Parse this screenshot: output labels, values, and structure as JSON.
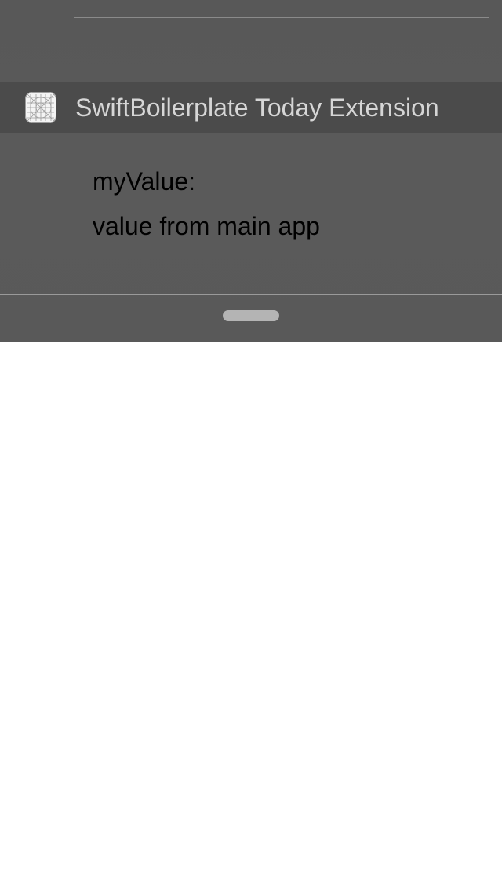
{
  "widget": {
    "title": "SwiftBoilerplate Today Extension",
    "icon": "app-placeholder-icon",
    "value_label": "myValue:",
    "value_text": "value from main app"
  },
  "colors": {
    "panel_background": "#595959",
    "header_background": "#4b4b4b",
    "title_text": "#d6d6d6",
    "body_text": "#000000",
    "grabber": "#b4b4b4",
    "below_background": "#ffffff"
  }
}
